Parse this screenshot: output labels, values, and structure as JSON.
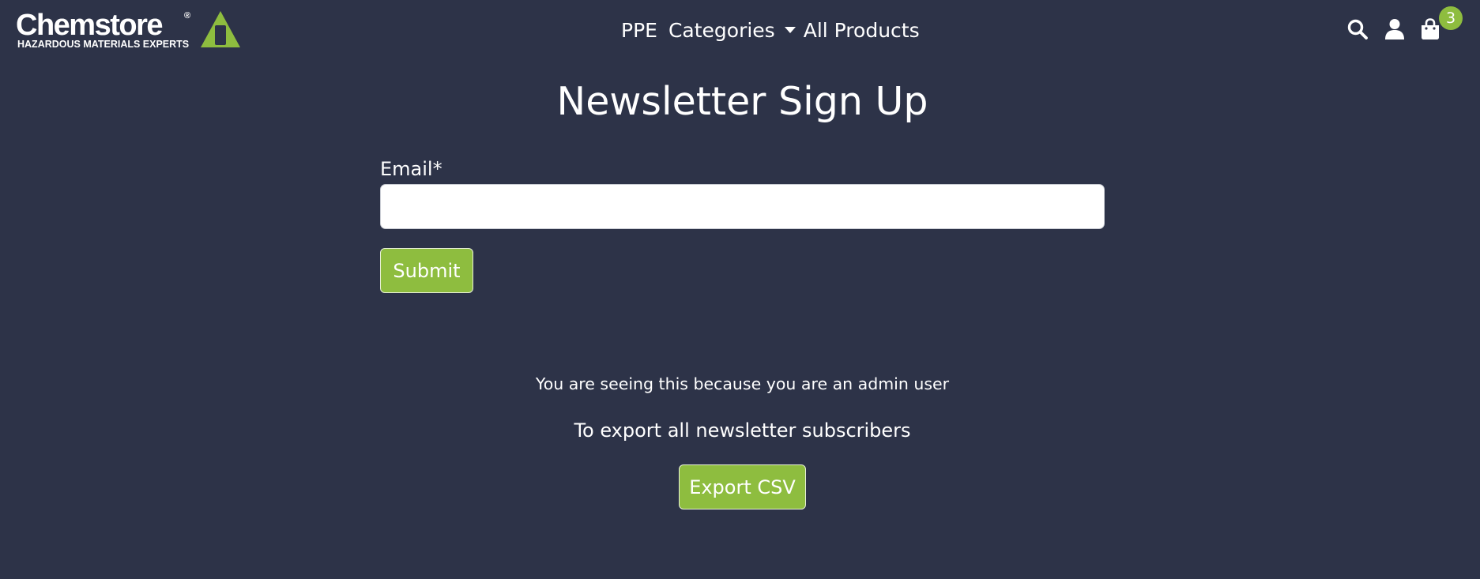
{
  "brand": {
    "name": "Chemstore",
    "registered": "®",
    "tagline": "HAZARDOUS MATERIALS EXPERTS",
    "accent_color": "#8ebd3f",
    "background_color": "#2d3348"
  },
  "nav": {
    "items": [
      {
        "label": "PPE"
      },
      {
        "label": "Categories",
        "dropdown": true
      },
      {
        "label": "All Products"
      }
    ]
  },
  "header_icons": {
    "search": "search-icon",
    "account": "user-icon",
    "cart": "shopping-bag-icon",
    "cart_count": "3"
  },
  "form": {
    "title": "Newsletter Sign Up",
    "email_label": "Email*",
    "email_value": "",
    "submit_label": "Submit"
  },
  "admin": {
    "notice": "You are seeing this because you are an admin user",
    "export_text": "To export all newsletter subscribers",
    "export_button": "Export CSV"
  }
}
